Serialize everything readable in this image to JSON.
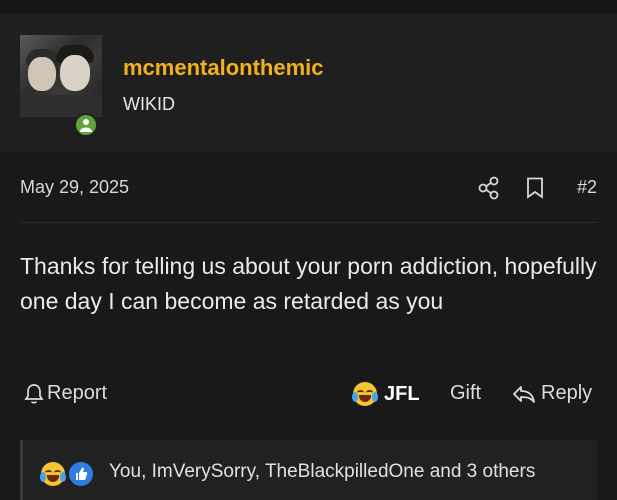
{
  "post": {
    "username": "mcmentalonthemic",
    "user_title": "WIKID",
    "date": "May 29, 2025",
    "post_number": "#2",
    "message": "Thanks for telling us about your porn addiction, hopefully one day I can become as retarded as you"
  },
  "actions": {
    "report_label": "Report",
    "jfl_label": "JFL",
    "gift_label": "Gift",
    "reply_label": "Reply"
  },
  "reactions": {
    "summary": "You, ImVerySorry, TheBlackpilledOne and 3 others",
    "icons": [
      "crying-laughing-emoji",
      "thumbs-up-icon"
    ]
  },
  "colors": {
    "username": "#f2b21b",
    "online": "#62a33b",
    "like": "#2f7de1",
    "background": "#191919"
  }
}
